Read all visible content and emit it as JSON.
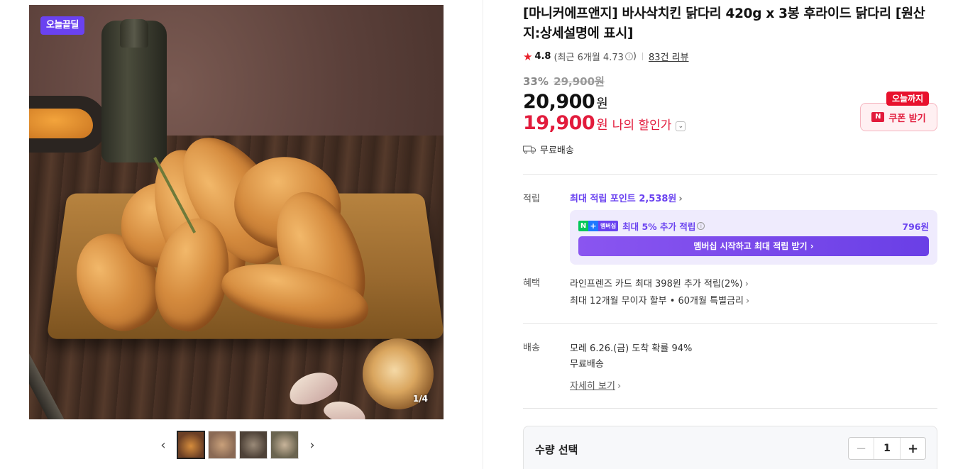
{
  "gallery": {
    "badge": "오늘끝딜",
    "counter": "1/4",
    "thumbs": [
      "thumb-1",
      "thumb-2",
      "thumb-3",
      "thumb-4"
    ],
    "prev_icon": "‹",
    "next_icon": "›"
  },
  "product": {
    "title": "[마니커에프앤지] 바사삭치킨 닭다리 420g x 3봉 후라이드 닭다리 [원산지:상세설명에 표시]",
    "rating": "4.8",
    "recent_rating": "(최근 6개월 4.73",
    "recent_close": ")",
    "review_count": "83건 리뷰",
    "discount_rate": "33%",
    "original_price": "29,900원",
    "price": "20,900",
    "price_unit": "원",
    "my_price": "19,900",
    "my_price_unit": "원",
    "my_price_label": "나의 할인가"
  },
  "coupon": {
    "tag": "오늘까지",
    "logo": "N",
    "button": "쿠폰 받기"
  },
  "shipping_summary": "무료배송",
  "points": {
    "label": "적립",
    "link": "최대 적립 포인트 ",
    "value": "2,538원",
    "member_n": "N",
    "member_plus": "+",
    "member_badge": "멤버십",
    "member_text": "최대 5% 추가 적립",
    "member_amount": "796원",
    "member_button": "멤버십 시작하고 최대 적립 받기 ›"
  },
  "benefits": {
    "label": "혜택",
    "line1": "라인프렌즈 카드 최대 398원 추가 적립(2%)",
    "line2": "최대 12개월 무이자 할부 • 60개월 특별금리"
  },
  "delivery": {
    "label": "배송",
    "eta": "모레 6.26.(금) 도착 확률 94%",
    "fee": "무료배송",
    "detail": "자세히 보기"
  },
  "quantity": {
    "label": "수량 선택",
    "value": "1",
    "minus": "−",
    "plus": "+"
  },
  "colors": {
    "accent_purple": "#6a42f0",
    "price_red": "#e21b3c",
    "star_red": "#e8202a"
  }
}
